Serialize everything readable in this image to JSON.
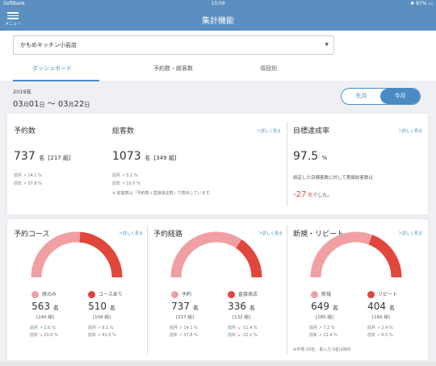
{
  "status": {
    "carrier": "SoftBank",
    "time": "13:09",
    "battery": "87%"
  },
  "nav": {
    "menu_label": "メニュー",
    "title": "集計機能"
  },
  "store_select": {
    "value": "かもめキッチン小岩店"
  },
  "tabs": [
    {
      "label": "ダッシュボード",
      "active": true
    },
    {
      "label": "予約数・総客数",
      "active": false
    },
    {
      "label": "項目別",
      "active": false
    }
  ],
  "period": {
    "year": "2019年",
    "start_month": "03",
    "start_day": "01",
    "end_month": "03",
    "end_day": "22",
    "unit_month": "月",
    "unit_day": "日",
    "sep": "〜",
    "prev_label": "先月",
    "current_label": "今月"
  },
  "summary": {
    "reservations": {
      "title": "予約数",
      "value": "737",
      "unit": "名",
      "sub": "[217 組]",
      "mom_label": "前月",
      "mom": "14.1 %",
      "yoy_label": "前年",
      "yoy": "37.8 %"
    },
    "total_guests": {
      "title": "総客数",
      "more": "＞詳しく見る",
      "value": "1073",
      "unit": "名",
      "sub": "[349 組]",
      "mom_label": "前月",
      "mom": "5.1 %",
      "yoy_label": "前年",
      "yoy": "10.5 %",
      "note": "※ 総客数は「予約数＋直接来店数」で算出しています。"
    },
    "target": {
      "title": "目標達成率",
      "more": "＞詳しく見る",
      "value": "97.5",
      "unit": "%",
      "desc": "設定した目標客数に対して実績総客数は",
      "diff": "-27",
      "diff_unit": "名",
      "diff_suffix": "でした。"
    }
  },
  "gauges": [
    {
      "title": "予約コース",
      "more": "＞詳しく見る",
      "left": {
        "label": "席のみ",
        "value": "563",
        "unit": "名",
        "groups": "[240 組]",
        "mom": "2.6 %",
        "mom_dir": "up",
        "yoy": "20.0 %",
        "yoy_dir": "down"
      },
      "right": {
        "label": "コースあり",
        "value": "510",
        "unit": "名",
        "groups": "[109 組]",
        "mom": "8.1 %",
        "mom_dir": "up",
        "yoy": "91.0 %",
        "yoy_dir": "up"
      },
      "left_share": 0.525
    },
    {
      "title": "予約経路",
      "more": "＞詳しく見る",
      "left": {
        "label": "予約",
        "value": "737",
        "unit": "名",
        "groups": "[217 組]",
        "mom": "14.1 %",
        "mom_dir": "up",
        "yoy": "37.8 %",
        "yoy_dir": "up"
      },
      "right": {
        "label": "直接来店",
        "value": "336",
        "unit": "名",
        "groups": "[132 組]",
        "mom": "-11.4 %",
        "mom_dir": "down",
        "yoy": "-22.1 %",
        "yoy_dir": "down"
      },
      "left_share": 0.687
    },
    {
      "title": "新規・リピート",
      "more": "＞詳しく見る",
      "left": {
        "label": "新規",
        "value": "649",
        "unit": "名",
        "groups": "[185 組]",
        "mom": "7.2 %",
        "mom_dir": "up",
        "yoy": "12.4 %",
        "yoy_dir": "up"
      },
      "right": {
        "label": "リピート",
        "value": "404",
        "unit": "名",
        "groups": "[160 組]",
        "mom": "2.4 %",
        "mom_dir": "up",
        "yoy": "6.5 %",
        "yoy_dir": "up"
      },
      "left_share": 0.616,
      "note": "※不明 20名、事入力 0名は除外"
    }
  ],
  "labels": {
    "mom": "前月",
    "yoy": "前年"
  },
  "colors": {
    "header": "#5b8fc1",
    "accent": "#4a8bc6",
    "gauge_left": "#f0a0a3",
    "gauge_right": "#e0463c",
    "up": "#3aaa4a",
    "down": "#e0463c"
  }
}
